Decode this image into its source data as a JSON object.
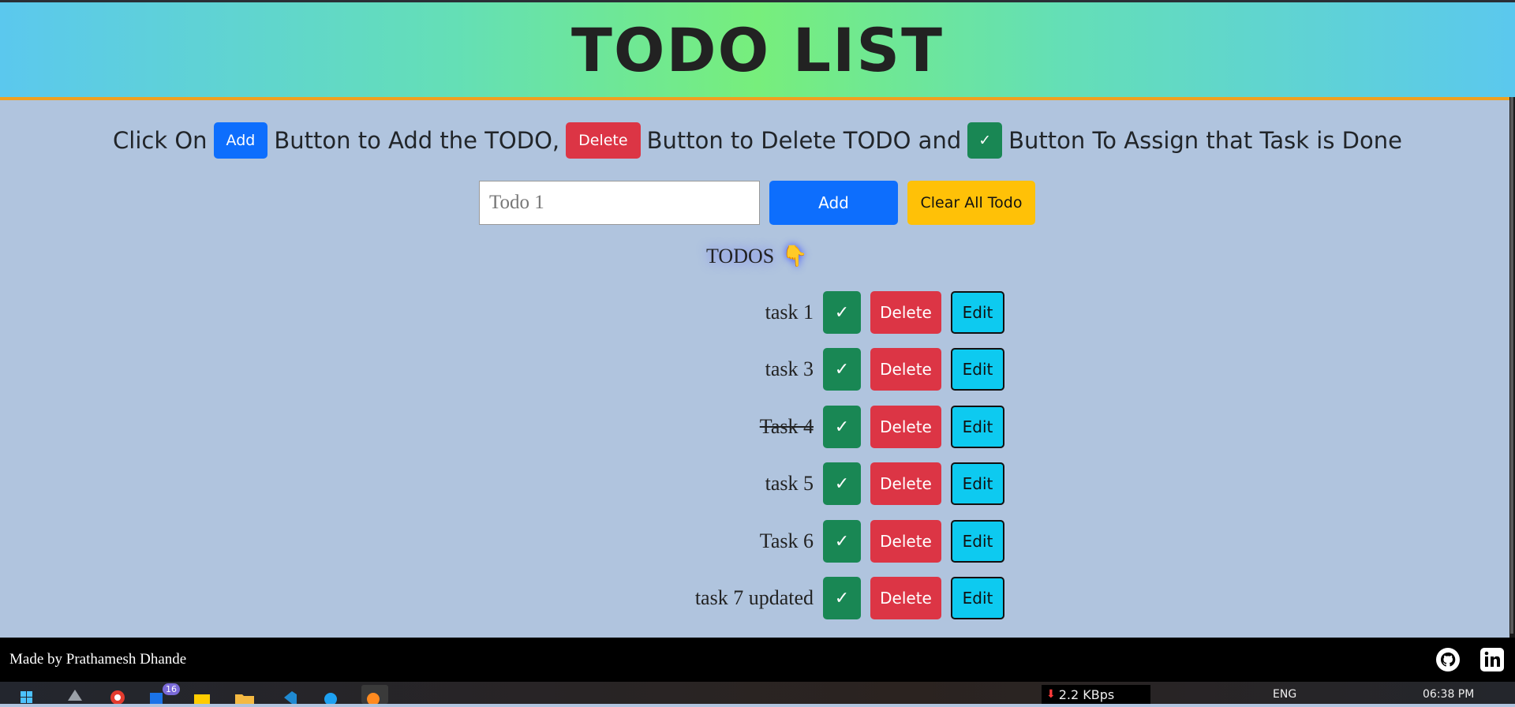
{
  "header": {
    "title": "TODO LIST"
  },
  "instructions": {
    "part1": "Click On",
    "add_label": "Add",
    "part2": "Button to Add the TODO,",
    "delete_label": "Delete",
    "part3": "Button to Delete TODO and",
    "check_label": "✓",
    "part4": "Button To Assign that Task is Done"
  },
  "form": {
    "input_placeholder": "Todo 1",
    "input_value": "",
    "add_button": "Add",
    "clear_button": "Clear All Todo"
  },
  "todos_heading": {
    "label": "TODOS",
    "icon": "👇"
  },
  "todos": [
    {
      "text": "task 1",
      "done": false,
      "check": "✓",
      "delete": "Delete",
      "edit": "Edit"
    },
    {
      "text": "task 3",
      "done": false,
      "check": "✓",
      "delete": "Delete",
      "edit": "Edit"
    },
    {
      "text": "Task 4",
      "done": true,
      "check": "✓",
      "delete": "Delete",
      "edit": "Edit"
    },
    {
      "text": "task 5",
      "done": false,
      "check": "✓",
      "delete": "Delete",
      "edit": "Edit"
    },
    {
      "text": "Task 6",
      "done": false,
      "check": "✓",
      "delete": "Delete",
      "edit": "Edit"
    },
    {
      "text": "task 7 updated",
      "done": false,
      "check": "✓",
      "delete": "Delete",
      "edit": "Edit"
    }
  ],
  "footer": {
    "credit": "Made by Prathamesh Dhande",
    "icons": [
      "github-icon",
      "linkedin-icon"
    ]
  },
  "taskbar": {
    "notification_badge": "16",
    "network_speed": "2.2 KBps",
    "language": "ENG",
    "time": "06:38 PM"
  },
  "colors": {
    "page_bg": "#b0c4de",
    "primary": "#0d6efd",
    "danger": "#dc3545",
    "success": "#198754",
    "warning": "#ffc107",
    "info": "#0dcaf0",
    "header_border": "#f0a020"
  }
}
